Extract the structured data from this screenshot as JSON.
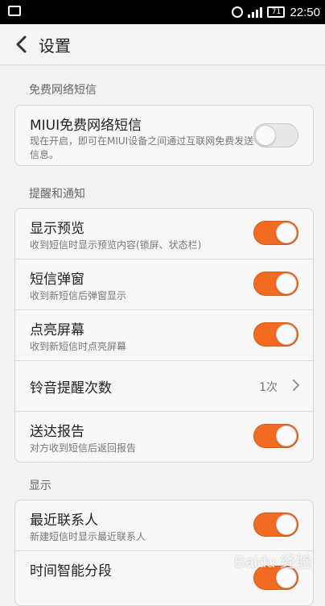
{
  "status_bar": {
    "time": "22:50",
    "battery": "71"
  },
  "header": {
    "title": "设置"
  },
  "sections": [
    {
      "header": "免费网络短信",
      "items": [
        {
          "title": "MIUI免费网络短信",
          "subtitle": "现在开启，即可在MIUI设备之间通过互联网免费发送信息。",
          "toggle": "off"
        }
      ]
    },
    {
      "header": "提醒和通知",
      "items": [
        {
          "title": "显示预览",
          "subtitle": "收到短信时显示预览内容(锁屏、状态栏)",
          "toggle": "on"
        },
        {
          "title": "短信弹窗",
          "subtitle": "收到新短信后弹窗显示",
          "toggle": "on"
        },
        {
          "title": "点亮屏幕",
          "subtitle": "收到新短信时点亮屏幕",
          "toggle": "on"
        },
        {
          "title": "铃音提醒次数",
          "value": "1次"
        },
        {
          "title": "送达报告",
          "subtitle": "对方收到短信后返回报告",
          "toggle": "on"
        }
      ]
    },
    {
      "header": "显示",
      "items": [
        {
          "title": "最近联系人",
          "subtitle": "新建短信时显示最近联系人",
          "toggle": "on"
        },
        {
          "title": "时间智能分段",
          "toggle": "on"
        }
      ]
    }
  ],
  "watermark": "Baidu 经验",
  "colors": {
    "accent": "#f16b22",
    "background": "#f2f2f2"
  }
}
